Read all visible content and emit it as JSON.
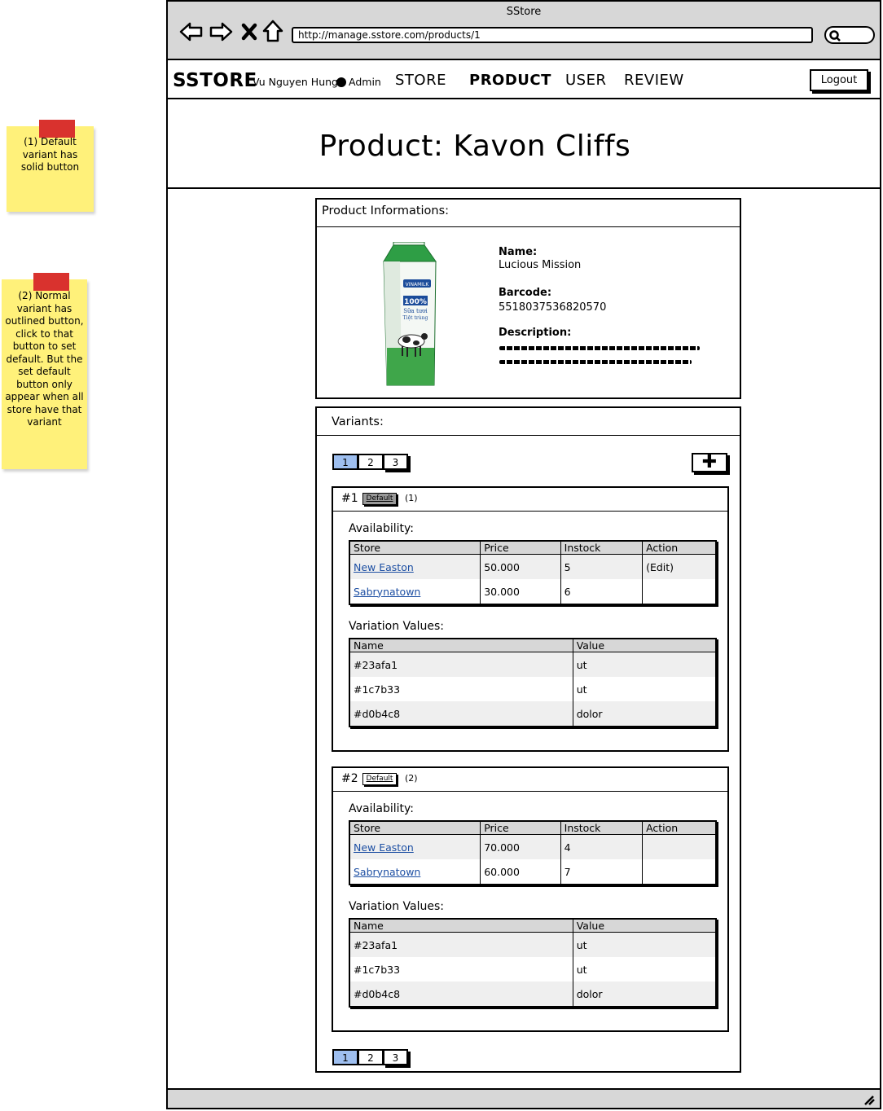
{
  "notes": [
    {
      "text": "(1) Default variant has solid button"
    },
    {
      "text": "(2) Normal variant has outlined button, click to that button to set default. But the set default button only appear when all store have that variant"
    }
  ],
  "window": {
    "title": "SStore",
    "url": "http://manage.sstore.com/products/1",
    "nav_icons": [
      "back-arrow-icon",
      "forward-arrow-icon",
      "stop-icon",
      "home-icon",
      "search-icon"
    ]
  },
  "navbar": {
    "brand": "SSTORE",
    "user_name": "Vu Nguyen Hung",
    "role": "Admin",
    "menu": [
      "STORE",
      "PRODUCT",
      "USER",
      "REVIEW"
    ],
    "active_menu": "PRODUCT",
    "logout": "Logout"
  },
  "page": {
    "title": "Product: Kavon Cliffs"
  },
  "product_info": {
    "heading": "Product Informations:",
    "name_label": "Name:",
    "name": "Lucious Mission",
    "barcode_label": "Barcode:",
    "barcode": "5518037536820570",
    "description_label": "Description:",
    "image_icon": "milk-carton-image",
    "carton": {
      "brand": "VINAMILK",
      "percent": "100%",
      "line1": "Sữa tươi",
      "line2": "Tiệt trùng"
    }
  },
  "variants_section": {
    "heading": "Variants:",
    "pages": [
      "1",
      "2",
      "3"
    ],
    "active_page": "1",
    "add_icon": "plus-icon"
  },
  "variants": [
    {
      "number": "#1",
      "default_label": "Default",
      "default_style": "solid",
      "note_ref": "(1)",
      "availability_label": "Availability:",
      "availability_columns": [
        "Store",
        "Price",
        "Instock",
        "Action"
      ],
      "availability_rows": [
        {
          "store": "New Easton",
          "price": "50.000",
          "instock": "5",
          "action": "(Edit)"
        },
        {
          "store": "Sabrynatown",
          "price": "30.000",
          "instock": "6",
          "action": ""
        }
      ],
      "values_label": "Variation Values:",
      "values_columns": [
        "Name",
        "Value"
      ],
      "values_rows": [
        {
          "name": "#23afa1",
          "value": "ut"
        },
        {
          "name": "#1c7b33",
          "value": "ut"
        },
        {
          "name": "#d0b4c8",
          "value": "dolor"
        }
      ]
    },
    {
      "number": "#2",
      "default_label": "Default",
      "default_style": "outline",
      "note_ref": "(2)",
      "availability_label": "Availability:",
      "availability_columns": [
        "Store",
        "Price",
        "Instock",
        "Action"
      ],
      "availability_rows": [
        {
          "store": "New Easton",
          "price": "70.000",
          "instock": "4",
          "action": ""
        },
        {
          "store": "Sabrynatown",
          "price": "60.000",
          "instock": "7",
          "action": ""
        }
      ],
      "values_label": "Variation Values:",
      "values_columns": [
        "Name",
        "Value"
      ],
      "values_rows": [
        {
          "name": "#23afa1",
          "value": "ut"
        },
        {
          "name": "#1c7b33",
          "value": "ut"
        },
        {
          "name": "#d0b4c8",
          "value": "dolor"
        }
      ]
    }
  ],
  "colors": {
    "chrome_gray": "#d7d7d7",
    "active_page": "#9ebff0",
    "link": "#1d4fa3",
    "note_yellow": "#fff17a",
    "note_tape": "#d9322e",
    "carton_green": "#2e9e45"
  }
}
